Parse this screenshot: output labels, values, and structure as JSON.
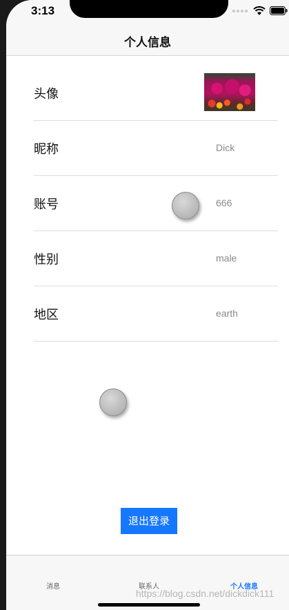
{
  "status_bar": {
    "time": "3:13"
  },
  "nav": {
    "title": "个人信息"
  },
  "profile": {
    "rows": [
      {
        "label": "头像",
        "value": ""
      },
      {
        "label": "昵称",
        "value": "Dick"
      },
      {
        "label": "账号",
        "value": "666"
      },
      {
        "label": "性别",
        "value": "male"
      },
      {
        "label": "地区",
        "value": "earth"
      }
    ]
  },
  "logout_label": "退出登录",
  "tabs": [
    {
      "label": "消息"
    },
    {
      "label": "联系人"
    },
    {
      "label": "个人信息"
    }
  ],
  "active_tab": "个人信息",
  "colors": {
    "accent": "#1677ff"
  },
  "watermark": "https://blog.csdn.net/dickdick111"
}
